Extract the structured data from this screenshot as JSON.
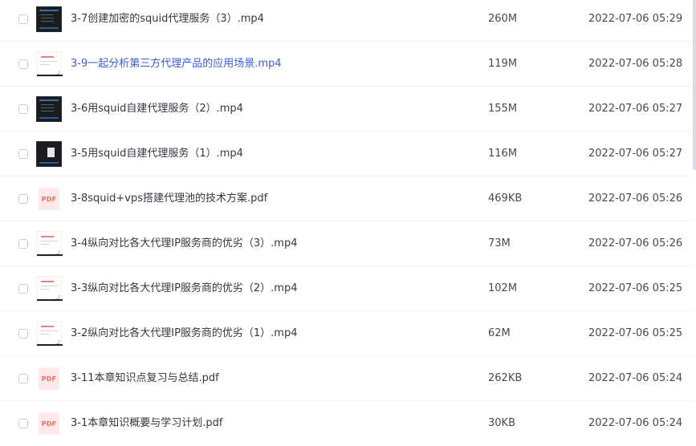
{
  "files": [
    {
      "name": "3-7创建加密的squid代理服务（3）.mp4",
      "size": "260M",
      "date": "2022-07-06 05:29",
      "thumb": "video-dark",
      "thumb_icon": "video-thumbnail-icon",
      "highlight": false
    },
    {
      "name": "3-9一起分析第三方代理产品的应用场景.mp4",
      "size": "119M",
      "date": "2022-07-06 05:28",
      "thumb": "video-light",
      "thumb_icon": "video-thumbnail-icon",
      "highlight": true
    },
    {
      "name": "3-6用squid自建代理服务（2）.mp4",
      "size": "155M",
      "date": "2022-07-06 05:27",
      "thumb": "video-dark",
      "thumb_icon": "video-thumbnail-icon",
      "highlight": false
    },
    {
      "name": "3-5用squid自建代理服务（1）.mp4",
      "size": "116M",
      "date": "2022-07-06 05:27",
      "thumb": "video-dark-page",
      "thumb_icon": "video-thumbnail-icon",
      "highlight": false
    },
    {
      "name": "3-8squid+vps搭建代理池的技术方案.pdf",
      "size": "469KB",
      "date": "2022-07-06 05:26",
      "thumb": "pdf",
      "thumb_icon": "pdf-icon",
      "highlight": false
    },
    {
      "name": "3-4纵向对比各大代理IP服务商的优劣（3）.mp4",
      "size": "73M",
      "date": "2022-07-06 05:26",
      "thumb": "video-light",
      "thumb_icon": "video-thumbnail-icon",
      "highlight": false
    },
    {
      "name": "3-3纵向对比各大代理IP服务商的优劣（2）.mp4",
      "size": "102M",
      "date": "2022-07-06 05:25",
      "thumb": "video-light",
      "thumb_icon": "video-thumbnail-icon",
      "highlight": false
    },
    {
      "name": "3-2纵向对比各大代理IP服务商的优劣（1）.mp4",
      "size": "62M",
      "date": "2022-07-06 05:25",
      "thumb": "video-light",
      "thumb_icon": "video-thumbnail-icon",
      "highlight": false
    },
    {
      "name": "3-11本章知识点复习与总结.pdf",
      "size": "262KB",
      "date": "2022-07-06 05:24",
      "thumb": "pdf",
      "thumb_icon": "pdf-icon",
      "highlight": false
    },
    {
      "name": "3-1本章知识概要与学习计划.pdf",
      "size": "30KB",
      "date": "2022-07-06 05:24",
      "thumb": "pdf",
      "thumb_icon": "pdf-icon",
      "highlight": false
    }
  ],
  "pdf_badge": "PDF",
  "colors": {
    "link": "#3b5bdb",
    "pdf_bg": "#fde9e9",
    "pdf_text": "#f06b6b",
    "text": "#333840"
  }
}
